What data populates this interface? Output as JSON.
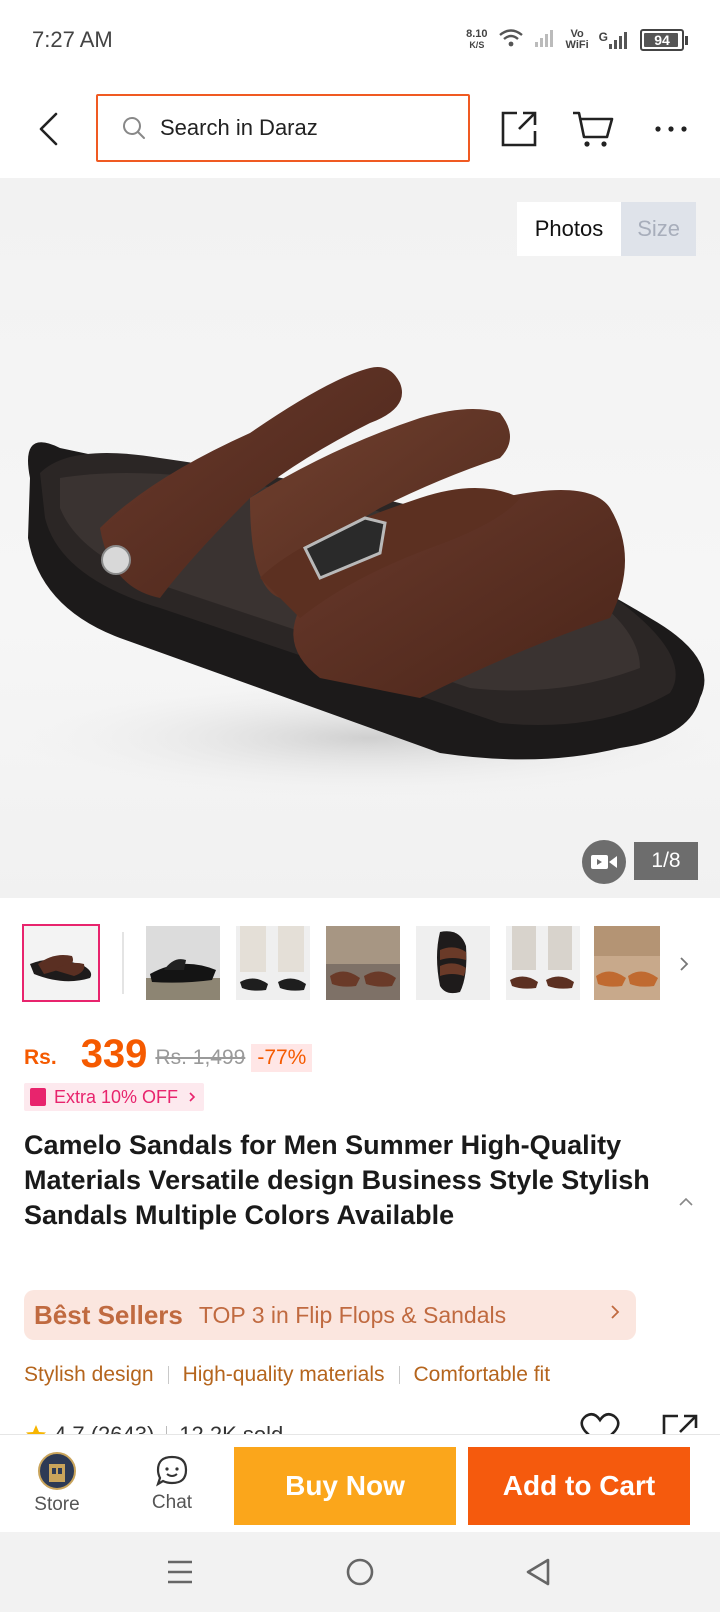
{
  "status_bar": {
    "time": "7:27 AM",
    "net_speed_value": "8.10",
    "net_speed_unit": "K/S",
    "vowifi_top": "Vo",
    "vowifi_bottom": "WiFi",
    "network_type": "G",
    "battery": "94",
    "battery_level": 0.94
  },
  "header": {
    "search_placeholder": "Search in Daraz",
    "accent_color": "#f05a22",
    "icons": [
      "back-arrow-icon",
      "search-icon",
      "share-icon",
      "cart-icon",
      "more-icon"
    ]
  },
  "gallery": {
    "toggle_photos": "Photos",
    "toggle_size": "Size",
    "page_counter": "1/8",
    "video_icon": "video-camera-icon"
  },
  "thumbnails": {
    "count": 8,
    "selected_index": 0
  },
  "price": {
    "currency": "Rs.",
    "current": "339",
    "original": "Rs. 1,499",
    "discount": "-77%",
    "voucher": "Extra 10% OFF",
    "price_color": "#f55a00"
  },
  "product": {
    "title": "Camelo Sandals for Men Summer High-Quality Materials Versatile design Business Style Stylish Sandals Multiple Colors Available"
  },
  "bestseller": {
    "label": "Bêst Sellers",
    "text": "TOP 3 in Flip Flops & Sandals"
  },
  "features": [
    "Stylish design",
    "High-quality materials",
    "Comfortable fit"
  ],
  "rating": {
    "score": "4.7 (2643)",
    "sold": "12.2K sold"
  },
  "bottom_bar": {
    "store_label": "Store",
    "chat_label": "Chat",
    "buy_now": "Buy Now",
    "add_to_cart": "Add to Cart",
    "buy_color": "#fba61b",
    "cart_color": "#f55a0d"
  },
  "nav_bar": {
    "icons": [
      "menu-icon",
      "home-icon",
      "back-icon"
    ]
  }
}
